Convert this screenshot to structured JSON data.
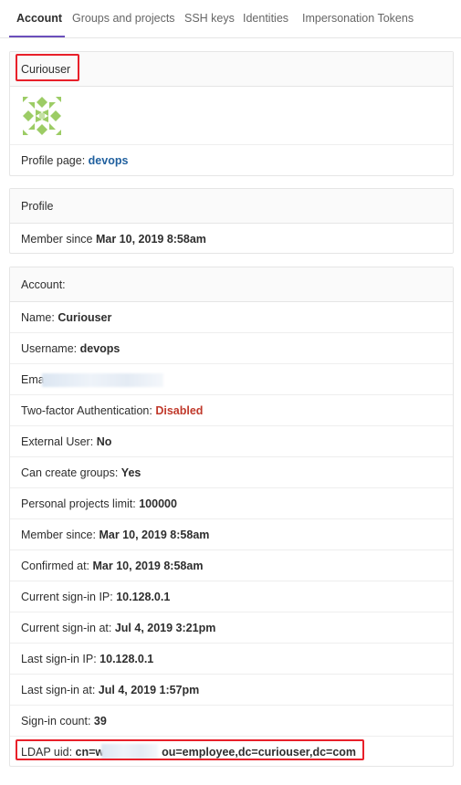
{
  "tabs": [
    {
      "label": "Account"
    },
    {
      "label": "Groups and projects"
    },
    {
      "label": "SSH keys"
    },
    {
      "label": "Identities"
    },
    {
      "label": "Impersonation Tokens"
    }
  ],
  "user_card": {
    "name": "Curiouser",
    "profile_label": "Profile page:",
    "profile_link": "devops",
    "avatar_icon": "identicon-avatar"
  },
  "profile_card": {
    "title": "Profile",
    "member_since_label": "Member since",
    "member_since_value": "Mar 10, 2019 8:58am"
  },
  "account_card": {
    "title": "Account:",
    "rows": [
      {
        "label": "Name:",
        "value": "Curiouser"
      },
      {
        "label": "Username:",
        "value": "devops"
      },
      {
        "label": "Ema",
        "value": ""
      },
      {
        "label": "Two-factor Authentication:",
        "value": "Disabled"
      },
      {
        "label": "External User:",
        "value": "No"
      },
      {
        "label": "Can create groups:",
        "value": "Yes"
      },
      {
        "label": "Personal projects limit:",
        "value": "100000"
      },
      {
        "label": "Member since:",
        "value": "Mar 10, 2019 8:58am"
      },
      {
        "label": "Confirmed at:",
        "value": "Mar 10, 2019 8:58am"
      },
      {
        "label": "Current sign-in IP:",
        "value": "10.128.0.1"
      },
      {
        "label": "Current sign-in at:",
        "value": "Jul 4, 2019 3:21pm"
      },
      {
        "label": "Last sign-in IP:",
        "value": "10.128.0.1"
      },
      {
        "label": "Last sign-in at:",
        "value": "Jul 4, 2019 1:57pm"
      },
      {
        "label": "Sign-in count:",
        "value": "39"
      },
      {
        "label": "LDAP uid:",
        "value_start": "cn=wa",
        "value_end": "ou=employee,dc=curiouser,dc=com"
      }
    ]
  },
  "colors": {
    "accent": "#6b4fbb",
    "danger": "#c0392b",
    "link": "#1f5f9e",
    "highlight": "#e8202a",
    "avatar": "#9ccc65"
  }
}
